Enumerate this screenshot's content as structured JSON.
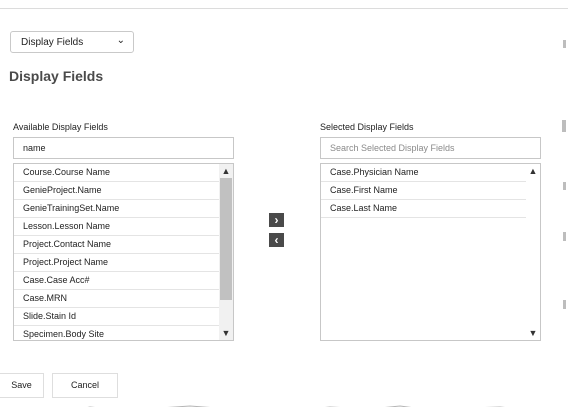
{
  "view_selector": {
    "value": "Display Fields"
  },
  "page_title": "Display Fields",
  "available": {
    "label": "Available Display Fields",
    "search_value": "name",
    "items": [
      "Course.Course Name",
      "GenieProject.Name",
      "GenieTrainingSet.Name",
      "Lesson.Lesson Name",
      "Project.Contact Name",
      "Project.Project Name",
      "Case.Case Acc#",
      "Case.MRN",
      "Slide.Stain Id",
      "Specimen.Body Site"
    ]
  },
  "selected": {
    "label": "Selected Display Fields",
    "search_placeholder": "Search Selected Display Fields",
    "items": [
      "Case.Physician Name",
      "Case.First Name",
      "Case.Last Name"
    ]
  },
  "actions": {
    "save_label": "Save",
    "cancel_label": "Cancel"
  },
  "icons": {
    "dropdown": "chevron-down-icon",
    "move_right": "chevron-right-icon",
    "move_left": "chevron-left-icon",
    "scroll_up": "scroll-up-icon",
    "scroll_down": "scroll-down-icon"
  },
  "colors": {
    "move_button": "#4a4a4a",
    "title": "#4a4a4a"
  }
}
